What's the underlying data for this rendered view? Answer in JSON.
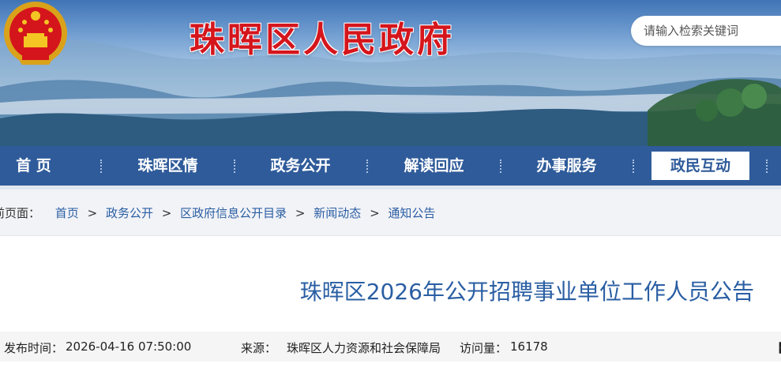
{
  "header": {
    "site_title": "珠晖区人民政府",
    "search_placeholder": "请输入检索关键词"
  },
  "nav": {
    "items": [
      {
        "label": "首 页",
        "active": false
      },
      {
        "label": "珠晖区情",
        "active": false
      },
      {
        "label": "政务公开",
        "active": false
      },
      {
        "label": "解读回应",
        "active": false
      },
      {
        "label": "办事服务",
        "active": false
      },
      {
        "label": "政民互动",
        "active": true
      }
    ]
  },
  "breadcrumb": {
    "label": "前页面：",
    "items": [
      "首页",
      "政务公开",
      "区政府信息公开目录",
      "新闻动态",
      "通知公告"
    ],
    "separator": ">"
  },
  "article": {
    "title": "珠晖区2026年公开招聘事业单位工作人员公告",
    "publish_label": "发布时间：",
    "publish_time": "2026-04-16 07:50:00",
    "source_label": "来源：",
    "source": "珠晖区人力资源和社会保障局",
    "views_label": "访问量：",
    "views": "16178",
    "bracket": "【"
  },
  "colors": {
    "title_red": "#d5151c",
    "nav_blue": "#2f5b9a",
    "link_blue": "#2a5ea3"
  },
  "icons": {
    "emblem": "national-emblem-icon"
  }
}
